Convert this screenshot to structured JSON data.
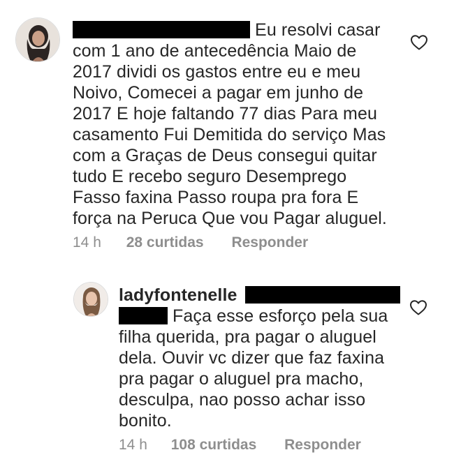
{
  "comments": [
    {
      "text": "Eu resolvi casar com 1 ano de antecedência Maio de 2017 dividi os gastos entre eu e meu Noivo, Comecei a pagar em junho de 2017 E hoje faltando 77 dias Para meu casamento Fui Demitida do serviço Mas com a Graças de Deus consegui quitar tudo E recebo seguro Desemprego Fasso faxina Passo roupa pra fora E força na Peruca Que vou Pagar aluguel.",
      "lines": [
        "Eu resolvi casar",
        "com 1 ano de antecedência Maio de",
        "2017 dividi os gastos entre eu e meu",
        "Noivo, Comecei a pagar em junho de",
        "2017 E hoje faltando 77 dias Para meu",
        "casamento Fui Demitida do serviço Mas",
        "com a Graças de Deus consegui quitar",
        "tudo E recebo seguro Desemprego",
        "Fasso faxina Passo roupa pra fora E",
        "força na Peruca Que vou Pagar aluguel."
      ],
      "time": "14 h",
      "likes": "28 curtidas",
      "reply_label": "Responder",
      "like_icon": "heart-outline-icon"
    },
    {
      "username": "ladyfontenelle",
      "lines": [
        "Faça esse esforço pela sua",
        "filha querida, pra pagar o aluguel",
        "dela. Ouvir vc dizer que faz faxina",
        "pra pagar o aluguel pra macho,",
        "desculpa, nao posso achar isso",
        "bonito."
      ],
      "time": "14 h",
      "likes": "108 curtidas",
      "reply_label": "Responder",
      "like_icon": "heart-outline-icon"
    }
  ],
  "colors": {
    "text": "#262626",
    "meta": "#8e8e8e",
    "redaction": "#000000"
  }
}
